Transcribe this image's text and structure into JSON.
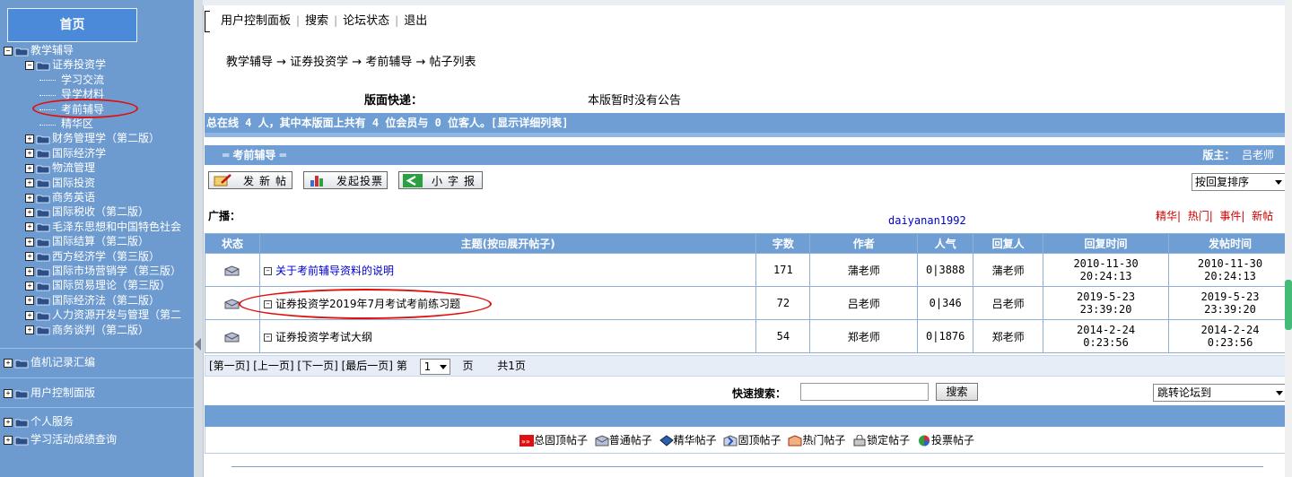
{
  "sidebar": {
    "home": "首页",
    "tree": [
      {
        "label": "教学辅导",
        "level": 0,
        "type": "open-folder"
      },
      {
        "label": "证券投资学",
        "level": 1,
        "type": "open-folder"
      },
      {
        "label": "学习交流",
        "level": 2,
        "type": "leaf"
      },
      {
        "label": "导学材料",
        "level": 2,
        "type": "leaf"
      },
      {
        "label": "考前辅导",
        "level": 2,
        "type": "leaf"
      },
      {
        "label": "精华区",
        "level": 2,
        "type": "leaf"
      },
      {
        "label": "财务管理学（第二版）",
        "level": 1,
        "type": "folder"
      },
      {
        "label": "国际经济学",
        "level": 1,
        "type": "folder"
      },
      {
        "label": "物流管理",
        "level": 1,
        "type": "folder"
      },
      {
        "label": "国际投资",
        "level": 1,
        "type": "folder"
      },
      {
        "label": "商务英语",
        "level": 1,
        "type": "folder"
      },
      {
        "label": "国际税收（第二版）",
        "level": 1,
        "type": "folder"
      },
      {
        "label": "毛泽东思想和中国特色社会",
        "level": 1,
        "type": "folder"
      },
      {
        "label": "国际结算（第二版）",
        "level": 1,
        "type": "folder"
      },
      {
        "label": "西方经济学（第三版）",
        "level": 1,
        "type": "folder"
      },
      {
        "label": "国际市场营销学（第三版）",
        "level": 1,
        "type": "folder"
      },
      {
        "label": "国际贸易理论（第三版）",
        "level": 1,
        "type": "folder"
      },
      {
        "label": "国际经济法（第二版）",
        "level": 1,
        "type": "folder"
      },
      {
        "label": "人力资源开发与管理（第二",
        "level": 1,
        "type": "folder"
      },
      {
        "label": "商务谈判（第二版）",
        "level": 1,
        "type": "folder"
      }
    ],
    "sections": [
      "值机记录汇编",
      "用户控制面版",
      "个人服务",
      "学习活动成绩查询"
    ]
  },
  "topbar": {
    "items": [
      "用户控制面板",
      "搜索",
      "论坛状态",
      "退出"
    ]
  },
  "breadcrumb": "教学辅导 → 证券投资学 → 考前辅导 → 帖子列表",
  "notice": {
    "label": "版面快递：",
    "text": "本版暂时没有公告"
  },
  "online": {
    "text": "总在线 4 人，其中本版面上共有 4 位会员与 0 位客人。",
    "link": "[显示详细列表]"
  },
  "forum": {
    "title": "═ 考前辅导 ═",
    "moderator_label": "版主：",
    "moderator": "吕老师"
  },
  "actions": {
    "new_post": "发新帖",
    "new_poll": "发起投票",
    "small_news": "小字报"
  },
  "sort": {
    "selected": "按回复排序"
  },
  "broadcast": {
    "label": "广播：",
    "user": "daiyanan1992"
  },
  "type_links": [
    "精华",
    "热门",
    "事件",
    "新帖"
  ],
  "table": {
    "headers": [
      "状态",
      "主题(按⊞展开帖子)",
      "字数",
      "作者",
      "人气",
      "回复人",
      "回复时间",
      "发帖时间"
    ],
    "rows": [
      {
        "subject": "关于考前辅导资料的说明",
        "link": true,
        "words": "171",
        "author": "蒲老师",
        "hits": "0|3888",
        "replier": "蒲老师",
        "reply_date": "2010-11-30",
        "reply_time": "20:24:13",
        "post_date": "2010-11-30",
        "post_time": "20:24:13"
      },
      {
        "subject": "证券投资学2019年7月考试考前练习题",
        "link": false,
        "words": "72",
        "author": "吕老师",
        "hits": "0|346",
        "replier": "吕老师",
        "reply_date": "2019-5-23",
        "reply_time": "23:39:20",
        "post_date": "2019-5-23",
        "post_time": "23:39:20"
      },
      {
        "subject": "证券投资学考试大纲",
        "link": false,
        "words": "54",
        "author": "郑老师",
        "hits": "0|1876",
        "replier": "郑老师",
        "reply_date": "2014-2-24",
        "reply_time": "0:23:56",
        "post_date": "2014-2-24",
        "post_time": "0:23:56"
      }
    ]
  },
  "pager": {
    "first": "[第一页]",
    "prev": "[上一页]",
    "next": "[下一页]",
    "last": "[最后一页]",
    "page_prefix": "第",
    "page": "1",
    "page_suffix": "页",
    "total": "共1页"
  },
  "search": {
    "label": "快速搜索：",
    "button": "搜索",
    "jump": "跳转论坛到"
  },
  "legend": [
    "总固顶帖子",
    "普通帖子",
    "精华帖子",
    "固顶帖子",
    "热门帖子",
    "锁定帖子",
    "投票帖子"
  ],
  "colors": {
    "sidebar": "#6d9bd0",
    "header_bar": "#6e9ed4",
    "annotation": "#e01010",
    "link": "#0000cc",
    "type_link": "#cc0000"
  }
}
